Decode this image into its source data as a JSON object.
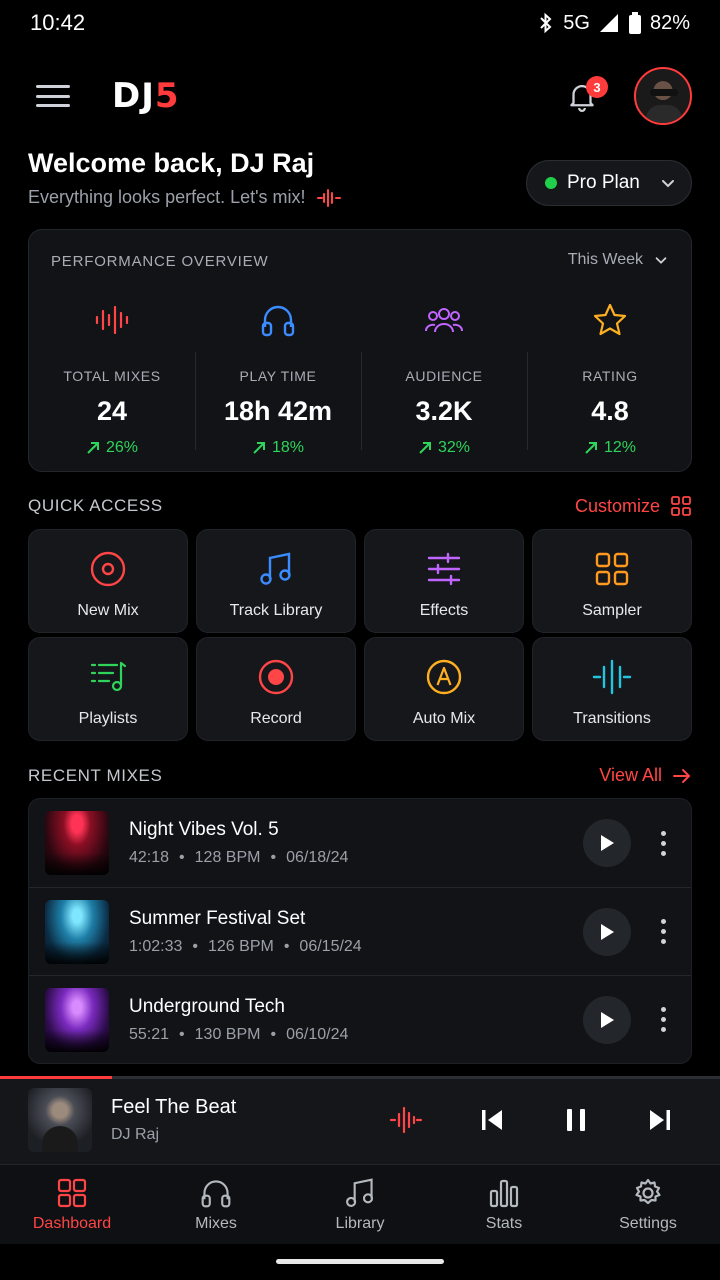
{
  "status": {
    "time": "10:42",
    "network": "5G",
    "battery": "82%"
  },
  "header": {
    "logo_main": "DJ",
    "logo_accent": "5",
    "notification_count": "3"
  },
  "welcome": {
    "title": "Welcome back, DJ Raj",
    "subtitle": "Everything looks perfect. Let's mix!"
  },
  "plan": {
    "label": "Pro Plan"
  },
  "performance": {
    "title": "PERFORMANCE OVERVIEW",
    "range": "This Week",
    "stats": [
      {
        "icon": "waveform-icon",
        "label": "TOTAL MIXES",
        "value": "24",
        "delta": "26%",
        "color": "#ff4545"
      },
      {
        "icon": "headphones-icon",
        "label": "PLAY TIME",
        "value": "18h 42m",
        "delta": "18%",
        "color": "#3b8cff"
      },
      {
        "icon": "audience-icon",
        "label": "AUDIENCE",
        "value": "3.2K",
        "delta": "32%",
        "color": "#c065ff"
      },
      {
        "icon": "star-icon",
        "label": "RATING",
        "value": "4.8",
        "delta": "12%",
        "color": "#ffb020"
      }
    ]
  },
  "quick_access": {
    "title": "QUICK ACCESS",
    "customize": "Customize",
    "items": [
      {
        "label": "New Mix",
        "icon": "record-disc-icon",
        "color": "#ff4545"
      },
      {
        "label": "Track Library",
        "icon": "music-note-icon",
        "color": "#3b8cff"
      },
      {
        "label": "Effects",
        "icon": "sliders-icon",
        "color": "#c065ff"
      },
      {
        "label": "Sampler",
        "icon": "grid-icon",
        "color": "#ff9a1f"
      },
      {
        "label": "Playlists",
        "icon": "playlist-icon",
        "color": "#2fd45a"
      },
      {
        "label": "Record",
        "icon": "record-icon",
        "color": "#ff4545"
      },
      {
        "label": "Auto Mix",
        "icon": "auto-mix-icon",
        "color": "#ffb020"
      },
      {
        "label": "Transitions",
        "icon": "transitions-icon",
        "color": "#22c5e0"
      }
    ]
  },
  "recent": {
    "title": "RECENT MIXES",
    "view_all": "View All",
    "mixes": [
      {
        "title": "Night Vibes Vol. 5",
        "duration": "42:18",
        "bpm": "128 BPM",
        "date": "06/18/24"
      },
      {
        "title": "Summer Festival Set",
        "duration": "1:02:33",
        "bpm": "126 BPM",
        "date": "06/15/24"
      },
      {
        "title": "Underground Tech",
        "duration": "55:21",
        "bpm": "130 BPM",
        "date": "06/10/24"
      }
    ]
  },
  "now_playing": {
    "title": "Feel The Beat",
    "artist": "DJ Raj",
    "progress": 0.155
  },
  "tabs": [
    {
      "label": "Dashboard",
      "icon": "dashboard-icon",
      "active": true
    },
    {
      "label": "Mixes",
      "icon": "headphones-icon",
      "active": false
    },
    {
      "label": "Library",
      "icon": "music-note-icon",
      "active": false
    },
    {
      "label": "Stats",
      "icon": "bar-chart-icon",
      "active": false
    },
    {
      "label": "Settings",
      "icon": "gear-icon",
      "active": false
    }
  ]
}
